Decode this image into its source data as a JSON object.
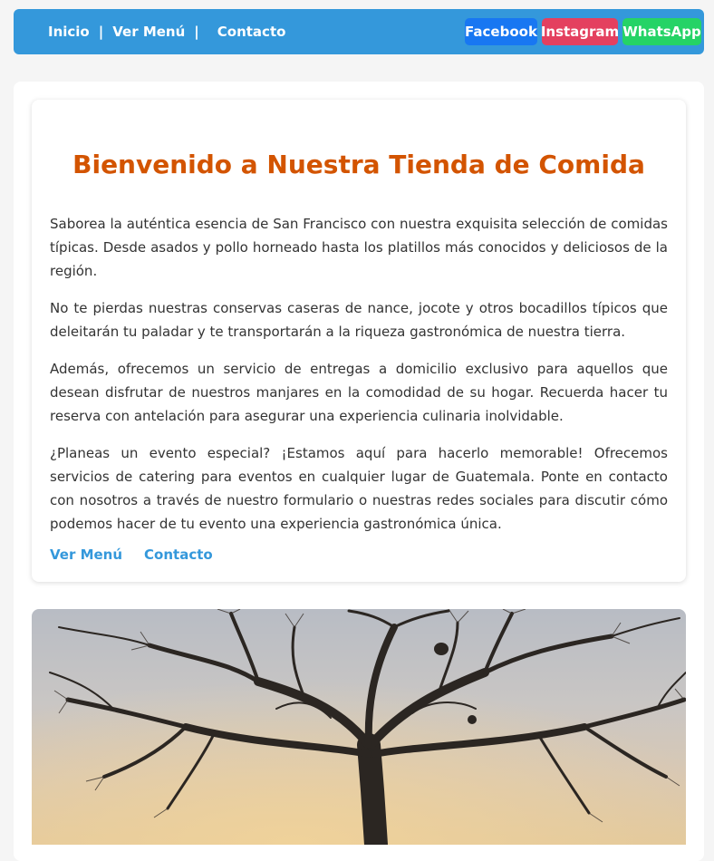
{
  "nav": {
    "links": [
      "Inicio",
      "Ver Menú",
      "Contacto"
    ],
    "separator": "|",
    "socials": {
      "facebook": "Facebook",
      "instagram": "Instagram",
      "whatsapp": "WhatsApp"
    }
  },
  "main": {
    "title": "Bienvenido a Nuestra Tienda de Comida",
    "paragraphs": [
      "Saborea la auténtica esencia de San Francisco con nuestra exquisita selección de comidas típicas. Desde asados y pollo horneado hasta los platillos más conocidos y deliciosos de la región.",
      "No te pierdas nuestras conservas caseras de nance, jocote y otros bocadillos típicos que deleitarán tu paladar y te transportarán a la riqueza gastronómica de nuestra tierra.",
      "Además, ofrecemos un servicio de entregas a domicilio exclusivo para aquellos que desean disfrutar de nuestros manjares en la comodidad de su hogar. Recuerda hacer tu reserva con antelación para asegurar una experiencia culinaria inolvidable.",
      "¿Planeas un evento especial? ¡Estamos aquí para hacerlo memorable! Ofrecemos servicios de catering para eventos en cualquier lugar de Guatemala. Ponte en contacto con nosotros a través de nuestro formulario o nuestras redes sociales para discutir cómo podemos hacer de tu evento una experiencia gastronómica única."
    ],
    "links": [
      "Ver Menú",
      "Contacto"
    ]
  },
  "colors": {
    "nav_bg": "#3498db",
    "title": "#d35400",
    "link": "#3498db",
    "facebook": "#1877f2",
    "instagram": "#e4405f",
    "whatsapp": "#25d366"
  }
}
